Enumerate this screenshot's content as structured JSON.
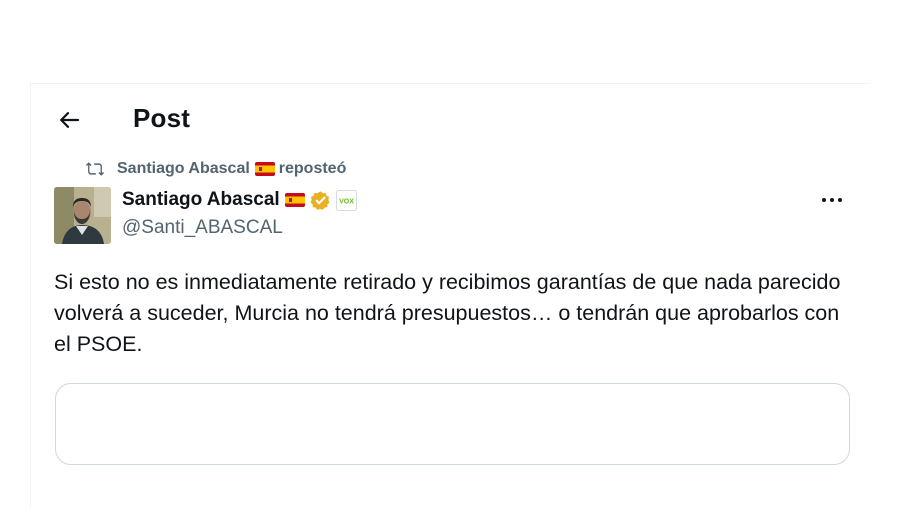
{
  "header": {
    "back_icon": "arrow-left-icon",
    "title": "Post"
  },
  "repost": {
    "icon": "repost-icon",
    "user": "Santiago Abascal",
    "flag": "spain-flag-icon",
    "action": "reposteó"
  },
  "post": {
    "author": {
      "name": "Santiago Abascal",
      "handle": "@Santi_ABASCAL",
      "verified_badge": "verified-badge-icon",
      "affiliate_badge": "vox-affiliate-icon",
      "affiliate_text": "VOX"
    },
    "more_icon": "more-horizontal-icon",
    "text": "Si esto no es inmediatamente retirado y recibimos garantías de que nada parecido volverá a suceder, Murcia no tendrá presupuestos… o tendrán que aprobarlos con el PSOE."
  },
  "colors": {
    "text": "#0f1419",
    "secondary": "#536471",
    "border": "#cfd9de",
    "verified_gold": "#e8b123",
    "vox_green": "#63be21"
  }
}
